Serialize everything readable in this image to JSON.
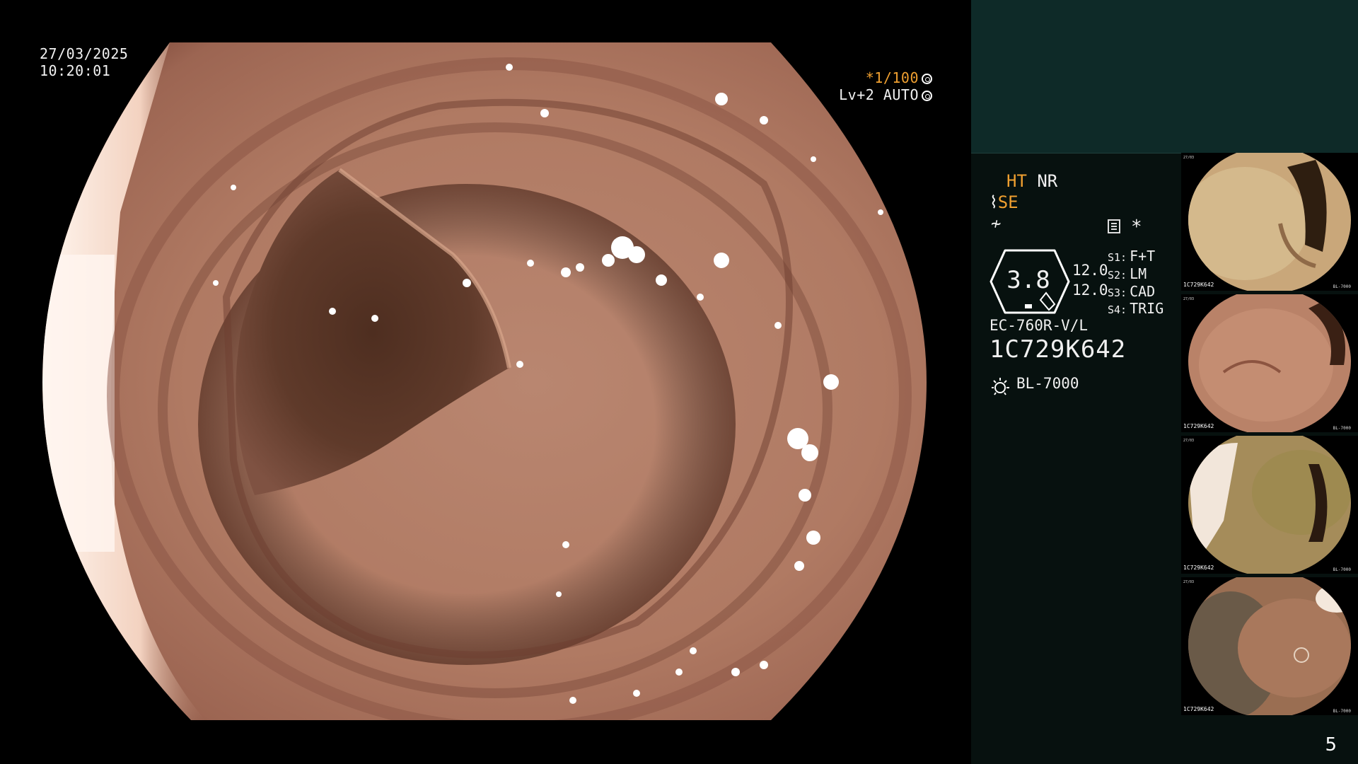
{
  "overlay": {
    "date": "27/03/2025",
    "time": "10:20:01",
    "shutter": "*1/100",
    "level": "Lv+2",
    "mode": "AUTO"
  },
  "status": {
    "ht": "HT",
    "nr": "NR",
    "se": "SE",
    "asterisk": "*",
    "zoom": "3.8",
    "zoom_a": "12.0",
    "zoom_b": "12.0",
    "switches": [
      {
        "key": "S1:",
        "value": "F+T"
      },
      {
        "key": "S2:",
        "value": "LM"
      },
      {
        "key": "S3:",
        "value": "CAD"
      },
      {
        "key": "S4:",
        "value": "TRIG"
      }
    ],
    "scope_model": "EC-760R-V/L",
    "scope_serial": "1C729K642",
    "light_source": "BL-7000"
  },
  "thumbnails": [
    {
      "serial": "1C729K642",
      "light": "BL-7000",
      "index": "4"
    },
    {
      "serial": "1C729K642",
      "light": "BL-7000",
      "index": "3"
    },
    {
      "serial": "1C729K642",
      "light": "BL-7000",
      "index": "2"
    },
    {
      "serial": "1C729K642",
      "light": "BL-7000",
      "index": "1"
    }
  ],
  "page_number": "5",
  "colors": {
    "panel_top": "#0e2a28",
    "panel_bottom": "#07110f",
    "accent_orange": "#f0a030"
  }
}
